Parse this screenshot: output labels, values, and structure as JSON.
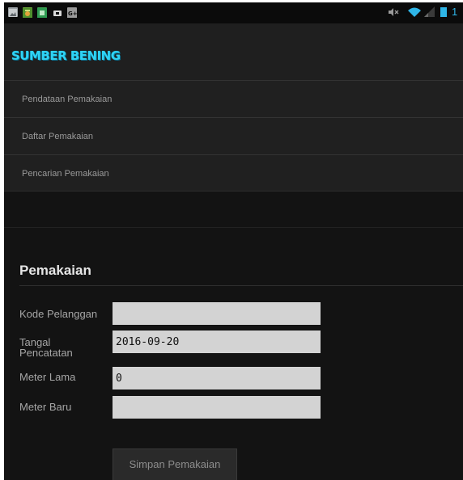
{
  "status_bar": {
    "icons": [
      "gallery-icon",
      "app-icon-android",
      "app-icon-green",
      "media-icon",
      "google-plus-icon"
    ],
    "right_icons": [
      "volume-muted-icon",
      "wifi-icon",
      "signal-icon",
      "battery-icon"
    ],
    "battery_partial": "1"
  },
  "header": {
    "brand": "SUMBER BENING"
  },
  "menu": {
    "items": [
      {
        "label": "Pendataan Pemakaian"
      },
      {
        "label": "Daftar Pemakaian"
      },
      {
        "label": "Pencarian Pemakaian"
      }
    ]
  },
  "form": {
    "title": "Pemakaian",
    "fields": [
      {
        "label_line1": "Kode Pelanggan",
        "label_line2": "",
        "value": ""
      },
      {
        "label_line1": "Tangal",
        "label_line2": "Pencatatan",
        "value": "2016-09-20"
      },
      {
        "label_line1": "Meter Lama",
        "label_line2": "",
        "value": "0"
      },
      {
        "label_line1": "Meter Baru",
        "label_line2": "",
        "value": ""
      }
    ],
    "submit_label": "Simpan Pemakaian"
  },
  "colors": {
    "brand": "#2fd3f5",
    "background": "#131313",
    "field": "#d3d3d3"
  }
}
